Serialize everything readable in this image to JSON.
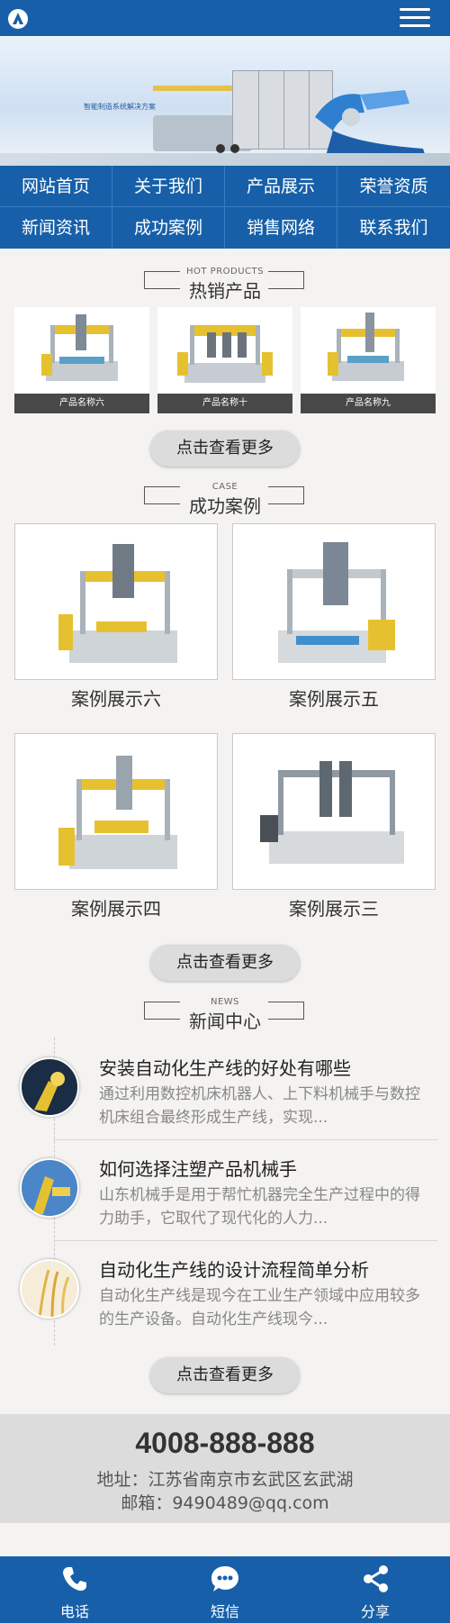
{
  "colors": {
    "primary": "#1760a9",
    "page_bg": "#f4f3f1",
    "button_bg": "#dcdcdc"
  },
  "header": {
    "logo_icon": "logo-icon",
    "menu_icon": "hamburger-menu-icon"
  },
  "banner": {
    "text": "智能制造系统解决方案"
  },
  "nav": [
    {
      "label": "网站首页"
    },
    {
      "label": "关于我们"
    },
    {
      "label": "产品展示"
    },
    {
      "label": "荣誉资质"
    },
    {
      "label": "新闻资讯"
    },
    {
      "label": "成功案例"
    },
    {
      "label": "销售网络"
    },
    {
      "label": "联系我们"
    }
  ],
  "hot_products": {
    "en": "HOT PRODUCTS",
    "title": "热销产品",
    "items": [
      {
        "name": "产品名称六"
      },
      {
        "name": "产品名称十"
      },
      {
        "name": "产品名称九"
      }
    ],
    "more": "点击查看更多"
  },
  "cases": {
    "en": "CASE",
    "title": "成功案例",
    "items": [
      {
        "name": "案例展示六"
      },
      {
        "name": "案例展示五"
      },
      {
        "name": "案例展示四"
      },
      {
        "name": "案例展示三"
      }
    ],
    "more": "点击查看更多"
  },
  "news": {
    "en": "NEWS",
    "title": "新闻中心",
    "items": [
      {
        "title": "安装自动化生产线的好处有哪些",
        "desc": "通过利用数控机床机器人、上下料机械手与数控机床组合最终形成生产线，实现..."
      },
      {
        "title": "如何选择注塑产品机械手",
        "desc": "山东机械手是用于帮忙机器完全生产过程中的得力助手，它取代了现代化的人力..."
      },
      {
        "title": "自动化生产线的设计流程简单分析",
        "desc": "自动化生产线是现今在工业生产领域中应用较多的生产设备。自动化生产线现今..."
      }
    ],
    "more": "点击查看更多"
  },
  "contact": {
    "phone": "4008-888-888",
    "address": "地址：江苏省南京市玄武区玄武湖",
    "email": "邮箱：9490489@qq.com"
  },
  "bottom_bar": [
    {
      "label": "电话",
      "icon": "phone-icon"
    },
    {
      "label": "短信",
      "icon": "message-icon"
    },
    {
      "label": "分享",
      "icon": "share-icon"
    }
  ]
}
